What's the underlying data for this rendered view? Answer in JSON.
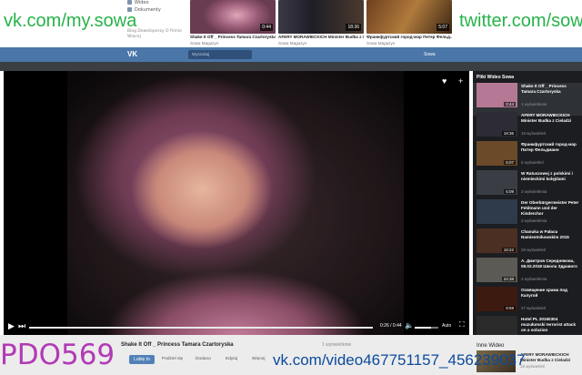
{
  "watermarks": {
    "left_url": "vk.com/my.sowa",
    "right_url": "twitter.com/sowa",
    "bottom_tag": "PDO569",
    "video_url": "vk.com/video467751157_456239037"
  },
  "vk_sidebar": {
    "items": [
      {
        "label": "Wideo",
        "icon": "video-icon"
      },
      {
        "label": "Dokumenty",
        "icon": "document-icon"
      }
    ],
    "footer": "Blog  Deweloperzy  O firmie  Więcej"
  },
  "top_thumbnails": [
    {
      "title": "Shake It Off _ Princess Tamara Czartoryska",
      "source": "Sowa Magazyn",
      "duration": "0:44",
      "color": "#b97c98"
    },
    {
      "title": "AFERY MORAWIECKICH Minister Budka z Cieladzi",
      "source": "Sowa Magazyn",
      "duration": "18:36",
      "color": "#2c2a36"
    },
    {
      "title": "Франкфуртский город-мэр Петер Фельд...",
      "source": "Sowa Magazyn",
      "duration": "5:07",
      "color": "#8a5a2c"
    }
  ],
  "vk_header": {
    "logo": "VK",
    "search_placeholder": "Wyszukaj",
    "user_label": "Sowa"
  },
  "player": {
    "current_time": "0:26",
    "total_time": "0:44",
    "time_label": "0:26 / 0:44",
    "quality": "Auto",
    "progress_fraction": 1.0,
    "volume_fraction": 0.7
  },
  "side_playlist": {
    "header": "Pliki Wideo Sowa",
    "items": [
      {
        "title": "Shake It Off _ Princess Tamara Czartoryska",
        "sub": "1 wyświetlenie",
        "duration": "0:44",
        "color": "#b57995",
        "active": true
      },
      {
        "title": "AFERY MORAWIECKICH Minister Budka z Cieladzi",
        "sub": "18 wyświetleń",
        "duration": "18:36",
        "color": "#2d2b33"
      },
      {
        "title": "Франкфуртский город-мэр Питер Фельдманн",
        "sub": "5 wyświetleń",
        "duration": "5:07",
        "color": "#6b4a2a"
      },
      {
        "title": "W Ratuszowej z polskimi i niemieckimi kolęjdami",
        "sub": "3 wyświetlenia",
        "duration": "6:09",
        "color": "#3a3d44"
      },
      {
        "title": "Der Oberbürgermeister Peter Feldmann und der Kinderchor",
        "sub": "2 wyświetlenia",
        "duration": "",
        "color": "#2f3a4a"
      },
      {
        "title": "Chanuka w Pałacu Namiestnikowskim 2015",
        "sub": "28 wyświetleń",
        "duration": "18:22",
        "color": "#4a2f22"
      },
      {
        "title": "A. Дмитров Середняковa, 08.02.2018 Школа Здравого",
        "sub": "4 wyświetlenia",
        "duration": "24:38",
        "color": "#5b5a54"
      },
      {
        "title": "Освящение храма под Калугой",
        "sub": "27 wyświetleń",
        "duration": "8:59",
        "color": "#3d1a10"
      },
      {
        "title": "Hotel PL 20160304 muzułumski terrorist attack on a soluzion",
        "sub": "",
        "duration": "",
        "color": "#2a2a2a"
      }
    ]
  },
  "below_video": {
    "title": "Shake It Off _ Princess Tamara Czartoryska",
    "views": "1 wyświetlenie",
    "like_label": "Lubię to",
    "actions": [
      "Podziel się",
      "Dodano",
      "Edytuj",
      "Więcej"
    ],
    "other_header": "Inne Wideo",
    "other_item": {
      "title": "AFERY MORAWIECKICH Minister Budka z Cieladzi",
      "sub": "18 wyświetleń"
    }
  }
}
